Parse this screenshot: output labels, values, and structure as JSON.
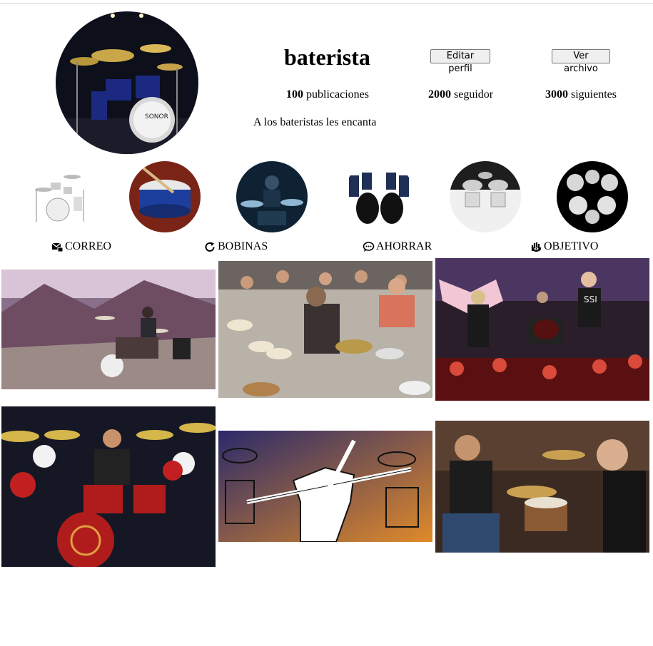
{
  "profile": {
    "username": "baterista",
    "edit_label": "Editar perfil",
    "archive_label": "Ver archivo",
    "posts_count": "100",
    "posts_label": "publicaciones",
    "followers_count": "2000",
    "followers_label": "seguidor",
    "following_count": "3000",
    "following_label": "siguientes",
    "bio": "A los bateristas les encanta"
  },
  "tabs": [
    {
      "label": "CORREO",
      "icon": "mail-icon"
    },
    {
      "label": "BOBINAS",
      "icon": "refresh-icon"
    },
    {
      "label": "AHORRAR",
      "icon": "speech-bubble-icon"
    },
    {
      "label": "OBJETIVO",
      "icon": "hand-eye-icon"
    }
  ],
  "colors": {
    "button_bg": "#efefef",
    "button_border": "#767676",
    "divider": "#d6d6d6"
  }
}
